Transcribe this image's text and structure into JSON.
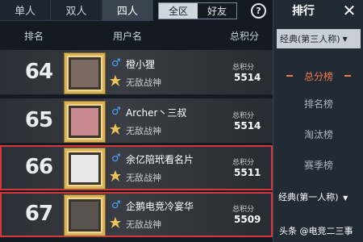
{
  "mode_tabs": [
    {
      "label": "单人",
      "active": false
    },
    {
      "label": "双人",
      "active": false
    },
    {
      "label": "四人",
      "active": true
    }
  ],
  "scope": {
    "all": "全区",
    "friends": "好友",
    "active": "全区"
  },
  "help_icon": "question-circle-icon",
  "header": {
    "rank": "排名",
    "user": "用户名",
    "score": "总积分"
  },
  "rows": [
    {
      "rank": "64",
      "gender": "♂",
      "name": "橙小狸",
      "title": "无敌战神",
      "score_label": "总积分",
      "score": "5514",
      "highlighted": false
    },
    {
      "rank": "65",
      "gender": "♂",
      "name": "Archer丶三叔",
      "title": "无敌战神",
      "score_label": "总积分",
      "score": "5514",
      "highlighted": false
    },
    {
      "rank": "66",
      "gender": "♂",
      "name": "余亿陪玳看名片",
      "title": "无敌战神",
      "score_label": "总积分",
      "score": "5511",
      "highlighted": true
    },
    {
      "rank": "67",
      "gender": "♂",
      "name": "企鹅电竞冷宴华",
      "title": "无敌战神",
      "score_label": "总积分",
      "score": "5509",
      "highlighted": true
    }
  ],
  "sidebar": {
    "title": "排行",
    "close": "✕",
    "select": "经典(第三人称)",
    "items": [
      {
        "label": "总分榜",
        "active": true
      },
      {
        "label": "排名榜",
        "active": false
      },
      {
        "label": "淘汰榜",
        "active": false
      },
      {
        "label": "赛季榜",
        "active": false
      }
    ],
    "select2": "经典(第一人称)"
  },
  "watermark": "头条 @电竞二三事",
  "colors": {
    "accent": "#f07a4a",
    "highlight_border": "#d8363a",
    "gender_male": "#4aa6ff",
    "frame_gold": "#d9b35a"
  }
}
